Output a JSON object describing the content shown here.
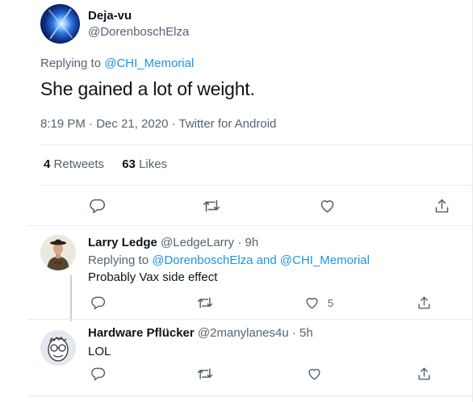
{
  "tweet": {
    "display_name": "Deja-vu",
    "handle": "@DorenboschElza",
    "replying_prefix": "Replying to",
    "replying_to": "@CHI_Memorial",
    "text": "She gained a lot of weight.",
    "meta": "8:19 PM · Dec 21, 2020 · Twitter for Android",
    "retweets_count": "4",
    "retweets_label": "Retweets",
    "likes_count": "63",
    "likes_label": "Likes",
    "actions": [
      "reply-icon",
      "retweet-icon",
      "like-icon",
      "share-icon"
    ]
  },
  "replies": [
    {
      "display_name": "Larry Ledge",
      "handle_time": "@LedgeLarry · 9h",
      "replying_prefix": "Replying to",
      "replying_to_1": "@DorenboschElza",
      "replying_and": "and",
      "replying_to_2": "@CHI_Memorial",
      "text": "Probably Vax side effect",
      "like_count": "5"
    },
    {
      "display_name": "Hardware Pflücker",
      "handle_time": "@2manylanes4u · 5h",
      "text": "LOL"
    }
  ],
  "colors": {
    "accent": "#1b95e0",
    "muted": "#536471",
    "text": "#0f1419",
    "border": "#e6ecf0"
  }
}
